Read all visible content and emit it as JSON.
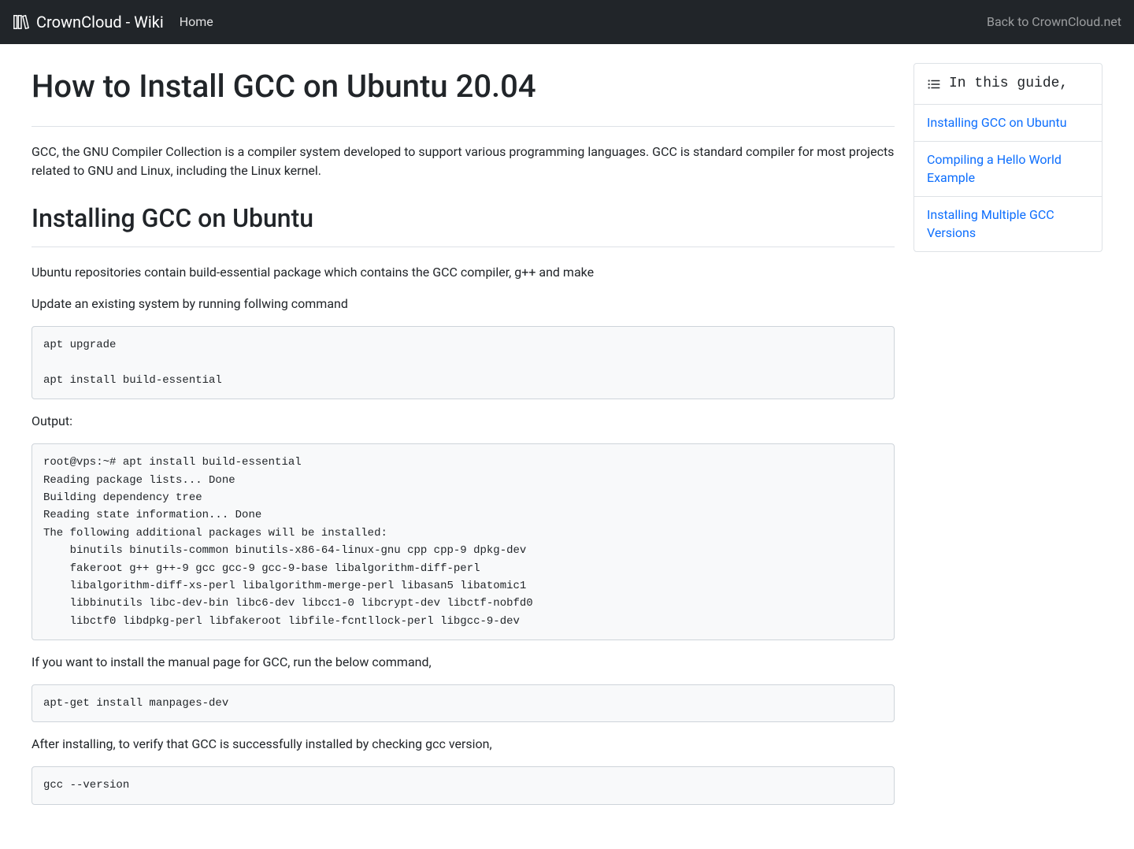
{
  "nav": {
    "brand": "CrownCloud - Wiki",
    "home": "Home",
    "back": "Back to CrownCloud.net"
  },
  "title": "How to Install GCC on Ubuntu 20.04",
  "intro": "GCC, the GNU Compiler Collection is a compiler system developed to support various programming languages. GCC is standard compiler for most projects related to GNU and Linux, including the Linux kernel.",
  "section1_heading": "Installing GCC on Ubuntu",
  "p_repos": "Ubuntu repositories contain build-essential package which contains the GCC compiler, g++ and make",
  "p_update": "Update an existing system by running follwing command",
  "code1": "apt upgrade\n\napt install build-essential",
  "p_output": "Output:",
  "code2": "root@vps:~# apt install build-essential\nReading package lists... Done\nBuilding dependency tree\nReading state information... Done\nThe following additional packages will be installed:\n    binutils binutils-common binutils-x86-64-linux-gnu cpp cpp-9 dpkg-dev\n    fakeroot g++ g++-9 gcc gcc-9 gcc-9-base libalgorithm-diff-perl\n    libalgorithm-diff-xs-perl libalgorithm-merge-perl libasan5 libatomic1\n    libbinutils libc-dev-bin libc6-dev libcc1-0 libcrypt-dev libctf-nobfd0\n    libctf0 libdpkg-perl libfakeroot libfile-fcntllock-perl libgcc-9-dev",
  "p_manpage": "If you want to install the manual page for GCC, run the below command,",
  "code3": "apt-get install manpages-dev",
  "p_verify": "After installing, to verify that GCC is successfully installed by checking gcc version,",
  "code4": "gcc --version",
  "toc": {
    "title": "In this guide,",
    "items": [
      "Installing GCC on Ubuntu",
      "Compiling a Hello World Example",
      "Installing Multiple GCC Versions"
    ]
  }
}
